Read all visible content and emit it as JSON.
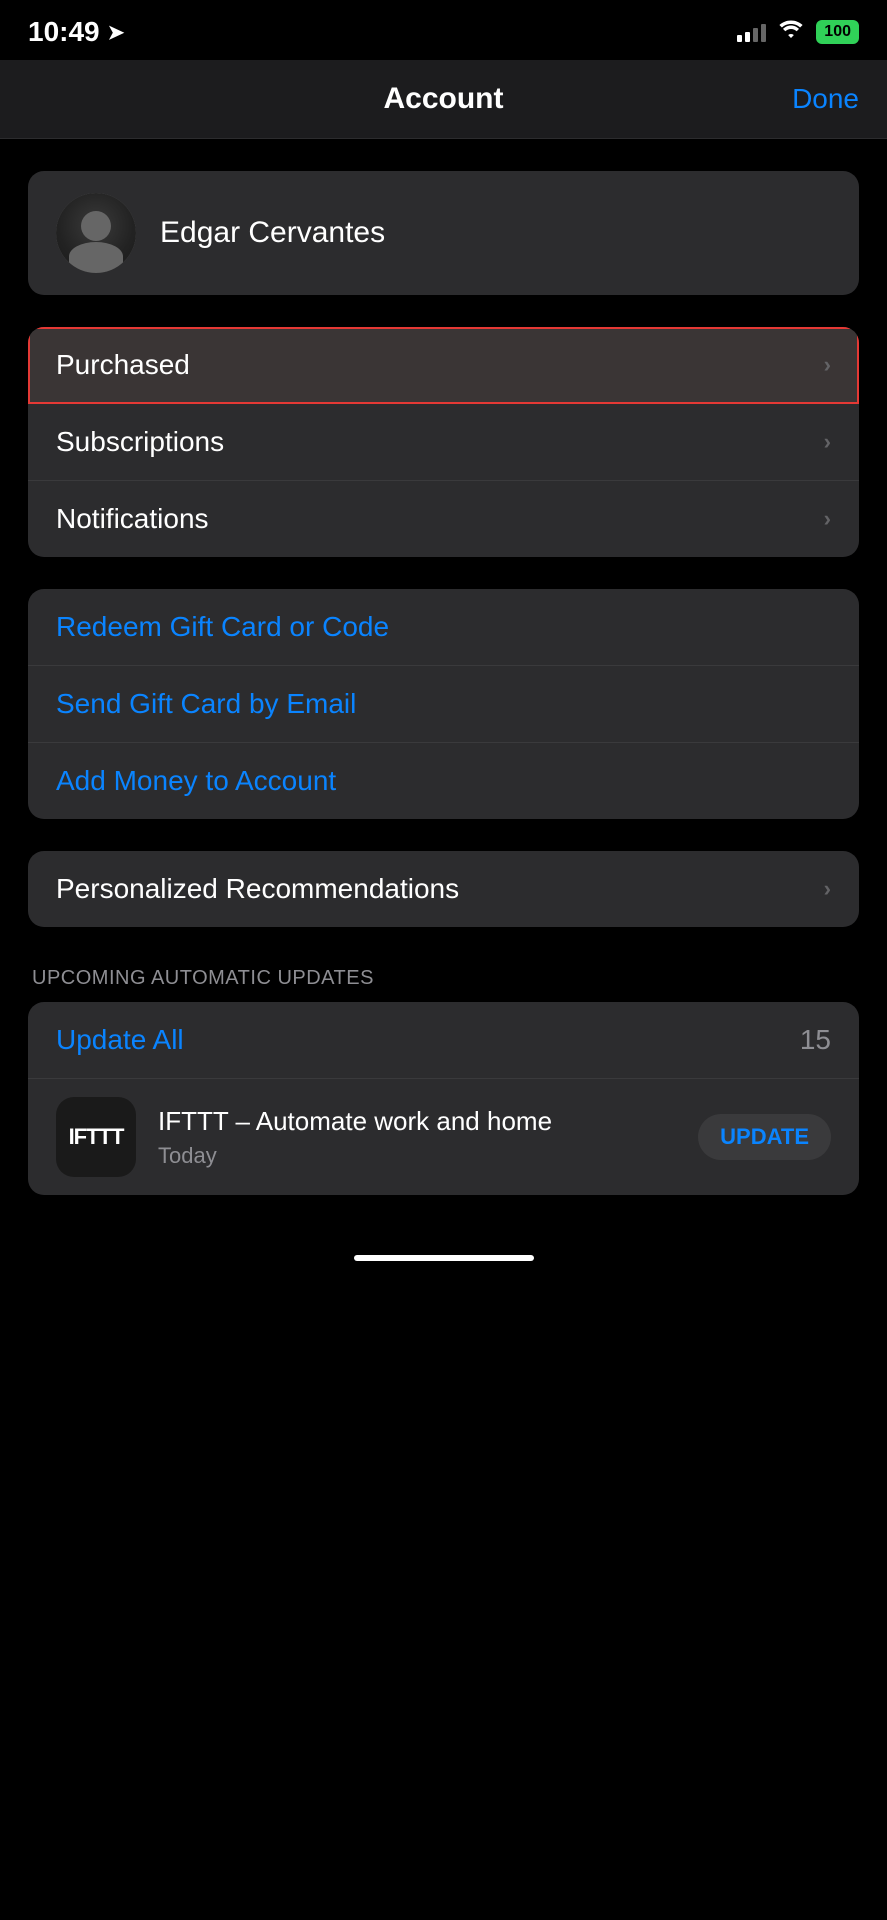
{
  "statusBar": {
    "time": "10:49",
    "batteryLevel": "100"
  },
  "header": {
    "title": "Account",
    "doneLabel": "Done"
  },
  "profile": {
    "name": "Edgar Cervantes"
  },
  "menuItems": [
    {
      "label": "Purchased",
      "highlighted": true
    },
    {
      "label": "Subscriptions",
      "highlighted": false
    },
    {
      "label": "Notifications",
      "highlighted": false
    }
  ],
  "giftCardItems": [
    {
      "label": "Redeem Gift Card or Code"
    },
    {
      "label": "Send Gift Card by Email"
    },
    {
      "label": "Add Money to Account"
    }
  ],
  "personalized": {
    "label": "Personalized Recommendations"
  },
  "upcomingUpdates": {
    "sectionLabel": "UPCOMING AUTOMATIC UPDATES",
    "updateAllLabel": "Update All",
    "updateCount": "15"
  },
  "appUpdate": {
    "appName": "IFTTT – Automate work and home",
    "appDate": "Today",
    "updateButtonLabel": "UPDATE",
    "logoText": "IFTTT"
  }
}
